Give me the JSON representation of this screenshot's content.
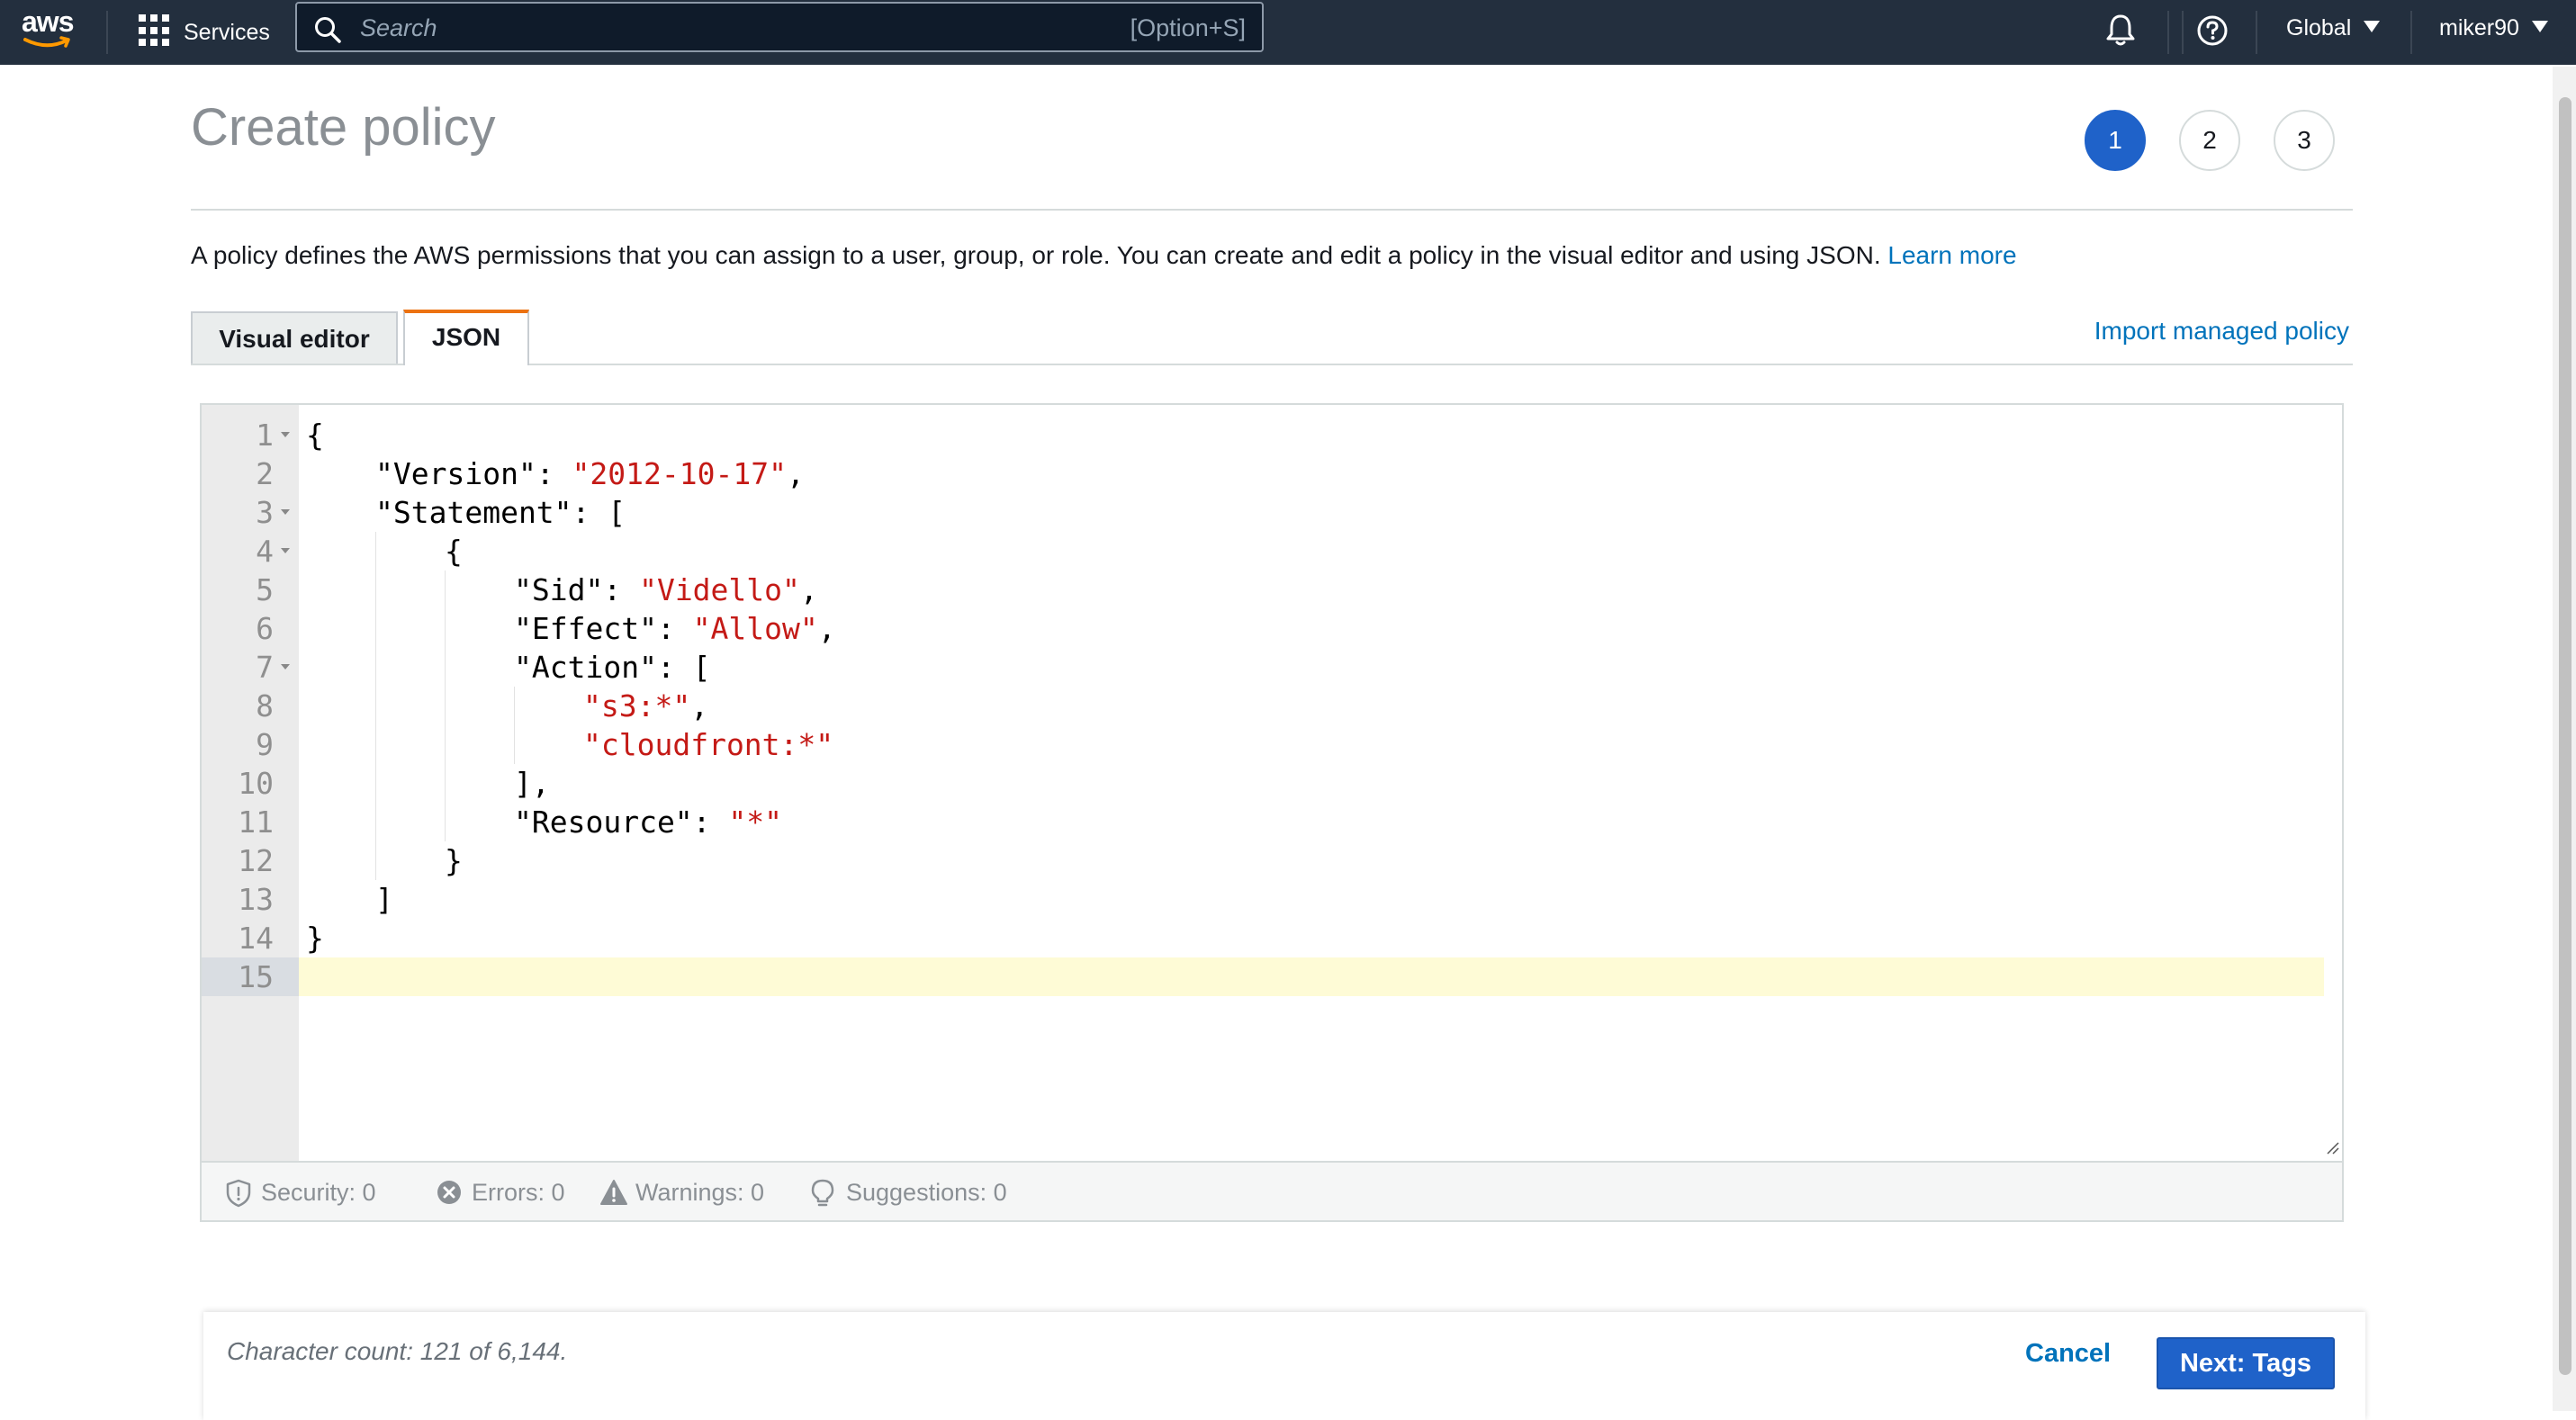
{
  "nav": {
    "logo_text": "aws",
    "services_label": "Services",
    "search_placeholder": "Search",
    "search_shortcut": "[Option+S]",
    "region_label": "Global",
    "user_label": "miker90"
  },
  "header": {
    "title": "Create policy",
    "steps": [
      "1",
      "2",
      "3"
    ],
    "active_step": 1,
    "description": "A policy defines the AWS permissions that you can assign to a user, group, or role. You can create and edit a policy in the visual editor and using JSON.",
    "learn_more": "Learn more"
  },
  "tabs": {
    "visual_editor": "Visual editor",
    "json": "JSON",
    "active": "JSON",
    "import_link": "Import managed policy"
  },
  "editor": {
    "current_line": 15,
    "lines": [
      {
        "n": "1",
        "fold": true,
        "indent": 0,
        "tokens": [
          {
            "t": "{"
          }
        ]
      },
      {
        "n": "2",
        "fold": false,
        "indent": 1,
        "tokens": [
          {
            "t": "\"Version\": "
          },
          {
            "t": "\"2012-10-17\"",
            "s": true
          },
          {
            "t": ","
          }
        ]
      },
      {
        "n": "3",
        "fold": true,
        "indent": 1,
        "tokens": [
          {
            "t": "\"Statement\": ["
          }
        ]
      },
      {
        "n": "4",
        "fold": true,
        "indent": 2,
        "tokens": [
          {
            "t": "{"
          }
        ]
      },
      {
        "n": "5",
        "fold": false,
        "indent": 3,
        "tokens": [
          {
            "t": "\"Sid\": "
          },
          {
            "t": "\"Vidello\"",
            "s": true
          },
          {
            "t": ","
          }
        ]
      },
      {
        "n": "6",
        "fold": false,
        "indent": 3,
        "tokens": [
          {
            "t": "\"Effect\": "
          },
          {
            "t": "\"Allow\"",
            "s": true
          },
          {
            "t": ","
          }
        ]
      },
      {
        "n": "7",
        "fold": true,
        "indent": 3,
        "tokens": [
          {
            "t": "\"Action\": ["
          }
        ]
      },
      {
        "n": "8",
        "fold": false,
        "indent": 4,
        "tokens": [
          {
            "t": "\"s3:*\"",
            "s": true
          },
          {
            "t": ","
          }
        ]
      },
      {
        "n": "9",
        "fold": false,
        "indent": 4,
        "tokens": [
          {
            "t": "\"cloudfront:*\"",
            "s": true
          }
        ]
      },
      {
        "n": "10",
        "fold": false,
        "indent": 3,
        "tokens": [
          {
            "t": "],"
          }
        ]
      },
      {
        "n": "11",
        "fold": false,
        "indent": 3,
        "tokens": [
          {
            "t": "\"Resource\": "
          },
          {
            "t": "\"*\"",
            "s": true
          }
        ]
      },
      {
        "n": "12",
        "fold": false,
        "indent": 2,
        "tokens": [
          {
            "t": "}"
          }
        ]
      },
      {
        "n": "13",
        "fold": false,
        "indent": 1,
        "tokens": [
          {
            "t": "]"
          }
        ]
      },
      {
        "n": "14",
        "fold": false,
        "indent": 0,
        "tokens": [
          {
            "t": "}"
          }
        ]
      },
      {
        "n": "15",
        "fold": false,
        "indent": 0,
        "tokens": []
      }
    ]
  },
  "status": {
    "security": "Security: 0",
    "errors": "Errors: 0",
    "warnings": "Warnings: 0",
    "suggestions": "Suggestions: 0"
  },
  "footer": {
    "character_count": "Character count: 121 of 6,144.",
    "cancel_label": "Cancel",
    "next_label": "Next: Tags"
  },
  "colors": {
    "nav_bg": "#232f3e",
    "primary": "#1f62c9",
    "link": "#0073bb",
    "tab_accent": "#ec7211",
    "json_string": "#c41a16",
    "current_line": "#fefbd6"
  },
  "icons": {
    "apps": "grid-icon",
    "search": "search-icon",
    "notifications": "bell-icon",
    "help": "help-icon",
    "security": "shield-icon",
    "errors": "error-icon",
    "warnings": "warning-icon",
    "suggestions": "lightbulb-icon"
  }
}
